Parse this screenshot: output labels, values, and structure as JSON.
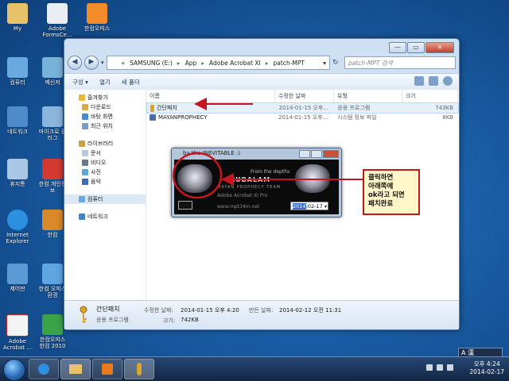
{
  "desktop": {
    "icons": [
      {
        "label": "My",
        "color": "#e8c26a"
      },
      {
        "label": "Adobe FormsCe...",
        "color": "#e9eef5"
      },
      {
        "label": "한컴오피스",
        "color": "#f28c2a"
      },
      {
        "label": "컴퓨터",
        "color": "#6aa8e0"
      },
      {
        "label": "메신저",
        "color": "#7ab1d8"
      },
      {
        "label": "네트워크",
        "color": "#4f8bcb"
      },
      {
        "label": "마이크로 플러그",
        "color": "#8ab5dc"
      },
      {
        "label": "휴지통",
        "color": "#a9c7e4"
      },
      {
        "label": "한컴 개인정보",
        "color": "#d33a2f"
      },
      {
        "label": "Internet Explorer",
        "color": "#2d8fe0"
      },
      {
        "label": "한컴",
        "color": "#d88a2a"
      },
      {
        "label": "제어판",
        "color": "#5a9bd6"
      },
      {
        "label": "한컴 오피스 환경",
        "color": "#5da6e2"
      },
      {
        "label": "Adobe Acrobat ...",
        "color": "#c8222a"
      },
      {
        "label": "한컴오피스 한컴 2010",
        "color": "#3aa34a"
      }
    ]
  },
  "explorer": {
    "address": {
      "root": "«",
      "crumbs": [
        "SAMSUNG (E:)",
        "App",
        "Adobe Acrobat XI",
        "patch-MPT"
      ],
      "separator": "▸",
      "dropdown": "▾"
    },
    "nav_buttons": {
      "back": "◀",
      "forward": "▶",
      "recent": "▾",
      "refresh": "↻"
    },
    "search_placeholder": "patch-MPT 검색",
    "window_controls": {
      "min": "—",
      "max": "▭",
      "close": "✕"
    },
    "toolbar": {
      "organize": "구성 ▾",
      "open": "열기",
      "new_folder": "새 폴더"
    },
    "nav": {
      "favorites": "즐겨찾기",
      "downloads": "다운로드",
      "desktop": "바탕 화면",
      "recent": "최근 위치",
      "libraries": "라이브러리",
      "documents": "문서",
      "videos": "비디오",
      "pictures": "사진",
      "music": "음악",
      "computer": "컴퓨터",
      "network": "네트워크"
    },
    "columns": {
      "name": "이름",
      "date": "수정한 날짜",
      "type": "유형",
      "size": "크기"
    },
    "files": [
      {
        "name": "간단패치",
        "date": "2014-01-15 오후...",
        "type": "응용 프로그램",
        "size": "743KB"
      },
      {
        "name": "MAYANPROPHECY",
        "date": "2014-01-15 오후...",
        "type": "시스템 정보 파일",
        "size": "8KB"
      }
    ],
    "details": {
      "name": "간단패치",
      "type": "응용 프로그램",
      "modified_label": "수정한 날짜:",
      "modified_value": "2014-01-15 오후 4:20",
      "created_label": "만든 날짜:",
      "created_value": "2014-02-12 오전 11:31",
      "size_label": "크기:",
      "size_value": "742KB"
    }
  },
  "patch_dialog": {
    "title": "by the INEVITABLE :)",
    "line1": "From the depths",
    "line2": "MAYAN PROPHECY TEAM",
    "line3": "Adobe Acrobat XI Pro",
    "line4": "www.mpt34m.net",
    "brand": "AJUBALAM",
    "date_year": "2014",
    "date_rest": "-02-17",
    "date_dropdown": "▾"
  },
  "annotation": {
    "lines": [
      "클릭하면",
      "아래쪽에",
      "ok라고 되면",
      "패치완료"
    ],
    "color": "#c4161c"
  },
  "taskbar": {
    "time": "오후 4:24",
    "date": "2014-02-17",
    "ime": "A 漢"
  }
}
